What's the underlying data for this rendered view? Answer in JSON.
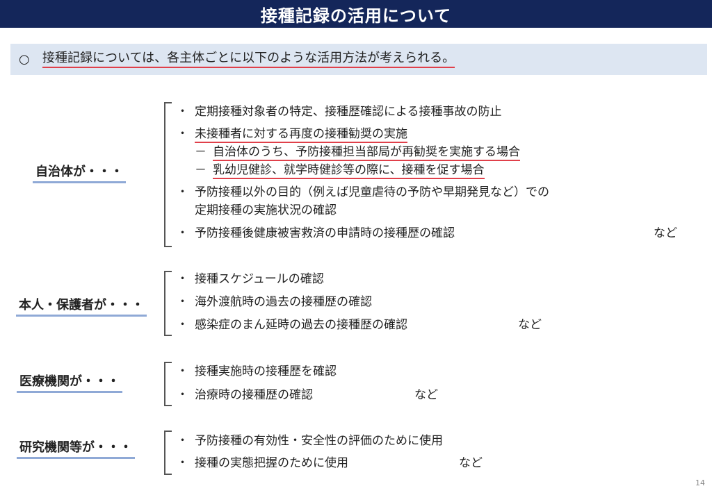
{
  "title": "接種記録の活用について",
  "intro": {
    "marker": "○",
    "text": "接種記録については、各主体ごとに以下のような活用方法が考えられる。"
  },
  "bullet": "・",
  "dash": "－",
  "suffix": "など",
  "groups": [
    {
      "subject": "自治体が・・・",
      "items": [
        "定期接種対象者の特定、接種歴確認による接種事故の防止",
        "未接種者に対する再度の接種勧奨の実施",
        "自治体のうち、予防接種担当部局が再勧奨を実施する場合",
        "乳幼児健診、就学時健診等の際に、接種を促す場合",
        "予防接種以外の目的（例えば児童虐待の予防や早期発見など）での",
        "定期接種の実施状況の確認",
        "予防接種後健康被害救済の申請時の接種歴の確認"
      ]
    },
    {
      "subject": "本人・保護者が・・・",
      "items": [
        "接種スケジュールの確認",
        "海外渡航時の過去の接種歴の確認",
        "感染症のまん延時の過去の接種歴の確認"
      ]
    },
    {
      "subject": "医療機関が・・・",
      "items": [
        "接種実施時の接種歴を確認",
        "治療時の接種歴の確認"
      ]
    },
    {
      "subject": "研究機関等が・・・",
      "items": [
        "予防接種の有効性・安全性の評価のために使用",
        "接種の実態把握のために使用"
      ]
    }
  ],
  "page_number": "14"
}
